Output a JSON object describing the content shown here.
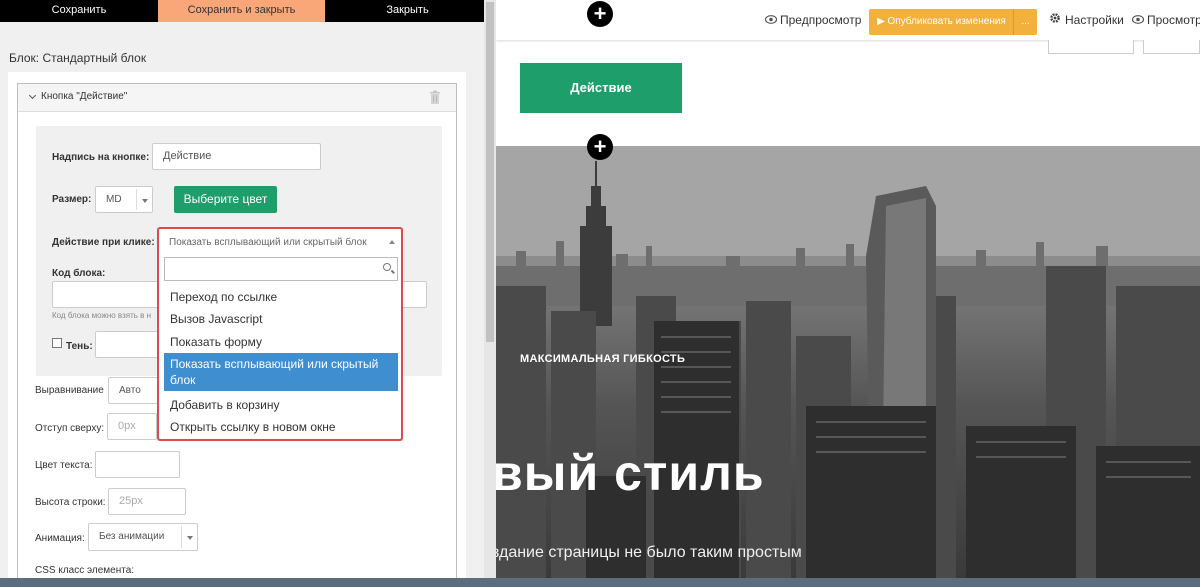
{
  "editor": {
    "topbar": {
      "save": "Сохранить",
      "save_close": "Сохранить и закрыть",
      "close": "Закрыть"
    },
    "block_title": "Блок: Стандартный блок",
    "card_title": "Кнопка \"Действие\"",
    "button_label": {
      "label": "Надпись на кнопке:",
      "value": "Действие"
    },
    "size": {
      "label": "Размер:",
      "value": "MD"
    },
    "choose_color": "Выберите цвет",
    "click_action": {
      "label": "Действие при клике:",
      "selected": "Показать всплывающий или скрытый блок",
      "options": [
        "Переход по ссылке",
        "Вызов Javascript",
        "Показать форму",
        "Показать всплывающий или скрытый блок",
        "Добавить в корзину",
        "Открыть ссылку в новом окне"
      ]
    },
    "block_code": {
      "label": "Код блока:",
      "hint": "Код блока можно взять в н"
    },
    "shadow": {
      "label": "Тень:"
    },
    "align": {
      "label": "Выравнивание",
      "value": "Авто"
    },
    "margin_top": {
      "label": "Отступ сверху:",
      "placeholder": "0px"
    },
    "text_color": {
      "label": "Цвет текста:"
    },
    "line_height": {
      "label": "Высота строки:",
      "placeholder": "25px"
    },
    "animation": {
      "label": "Анимация:",
      "value": "Без анимации"
    },
    "css_class": {
      "label": "CSS класс элемента:"
    }
  },
  "preview": {
    "preview_link": "Предпросмотр",
    "publish": "Опубликовать изменения",
    "publish_more": "...",
    "settings": "Настройки",
    "view": "Просмотр",
    "action_button": "Действие",
    "hero_kicker": "МАКСИМАЛЬНАЯ ГИБКОСТЬ",
    "hero_title": "вый стиль",
    "hero_sub": "здание страницы не было таким простым"
  },
  "colors": {
    "accent_green": "#1e9e6a",
    "accent_orange": "#f1b13c",
    "highlight_blue": "#3f8ed0",
    "error_red": "#e04a4a",
    "topbar_orange": "#f9a779"
  }
}
